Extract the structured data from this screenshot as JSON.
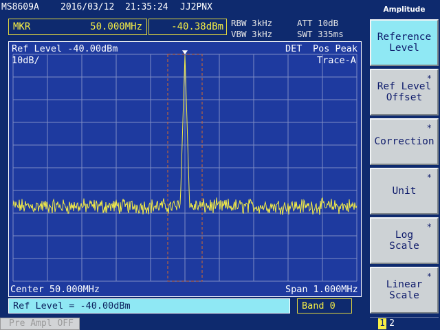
{
  "header": {
    "model": "MS8609A",
    "date": "2016/03/12",
    "time": "21:35:24",
    "user": "JJ2PNX"
  },
  "marker": {
    "label": "MKR",
    "frequency": "50.000MHz",
    "level": "-40.38dBm"
  },
  "params": {
    "rbw": "RBW 3kHz",
    "vbw": "VBW 3kHz",
    "att": "ATT 10dB",
    "swt": "SWT 335ms"
  },
  "screen": {
    "ref_level": "Ref Level -40.00dBm",
    "detector": "DET",
    "detector_mode": "Pos Peak",
    "scale": "10dB/",
    "trace": "Trace-A",
    "center": "Center 50.000MHz",
    "span": "Span 1.000MHz"
  },
  "trace_data": {
    "center_frequency_mhz": 50.0,
    "span_mhz": 1.0,
    "ref_level_dbm": -40.0,
    "db_per_div": 10,
    "noise_floor_dbm": -107,
    "peak_dbm": -40.38
  },
  "entry": {
    "text": "Ref Level = -40.00dBm",
    "band": "Band 0"
  },
  "status": {
    "pre_ampl": "Pre Ampl OFF"
  },
  "softkeys": {
    "title": "Amplitude",
    "items": [
      {
        "label": "Reference\nLevel",
        "star": ""
      },
      {
        "label": "Ref Level\nOffset",
        "star": "*"
      },
      {
        "label": "Correction",
        "star": "*"
      },
      {
        "label": "Unit",
        "star": "*"
      },
      {
        "label": "Log\nScale",
        "star": "*"
      },
      {
        "label": "Linear\nScale",
        "star": "*"
      }
    ],
    "page_current": "1",
    "page_next": "2"
  },
  "colors": {
    "background": "#0e2a6e",
    "graticule_bg": "#1e3a9f",
    "trace": "#f7ef45",
    "marker_window": "#d86a2a",
    "softkey_active": "#8fe8f4",
    "softkey": "#cdd2d5"
  }
}
